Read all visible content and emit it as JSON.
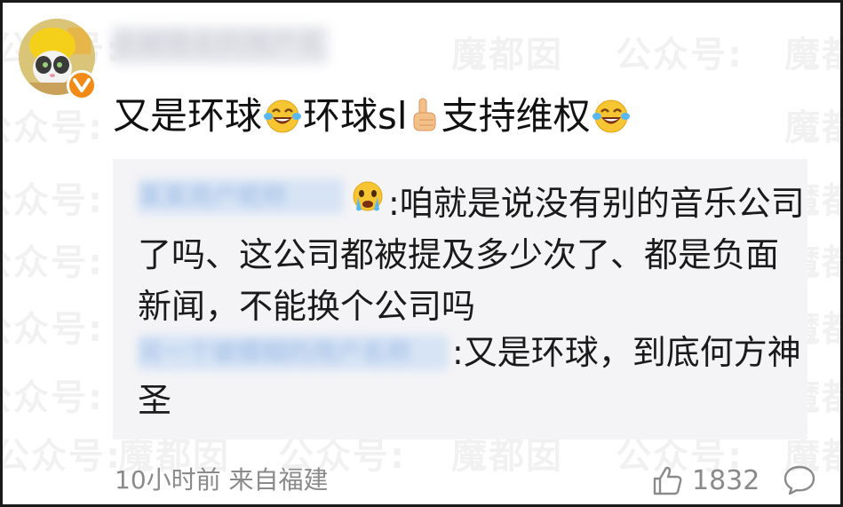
{
  "post": {
    "author_name": "会被隐去的用户名",
    "content_parts": [
      "又是环球",
      "环球sl",
      "支持维权"
    ],
    "emoji_icons": [
      "laughing-tears-emoji",
      "thumbs-up-emoji"
    ]
  },
  "quote": {
    "reply1_name": "某某用户昵称",
    "reply1_line1": ":咱就是说没有别的音乐公司",
    "reply1_line2": "了吗、这公司都被提及多少次了、都是负面",
    "reply1_line3": "新闻，不能换个公司吗",
    "reply2_name": "另一个被模糊的用户名称",
    "reply2_line1": ":又是环球，到底何方神",
    "reply2_line2": "圣",
    "emoji_icons": [
      "crying-emoji"
    ]
  },
  "footer": {
    "time_and_source": "10小时前 来自福建",
    "like_count": "1832"
  },
  "watermark": {
    "text_a": "魔都囡",
    "text_b": "公众号:"
  },
  "colors": {
    "verify_badge": "#f28a16",
    "quote_background": "#f4f4f6",
    "meta_text": "#8a8a8a"
  }
}
